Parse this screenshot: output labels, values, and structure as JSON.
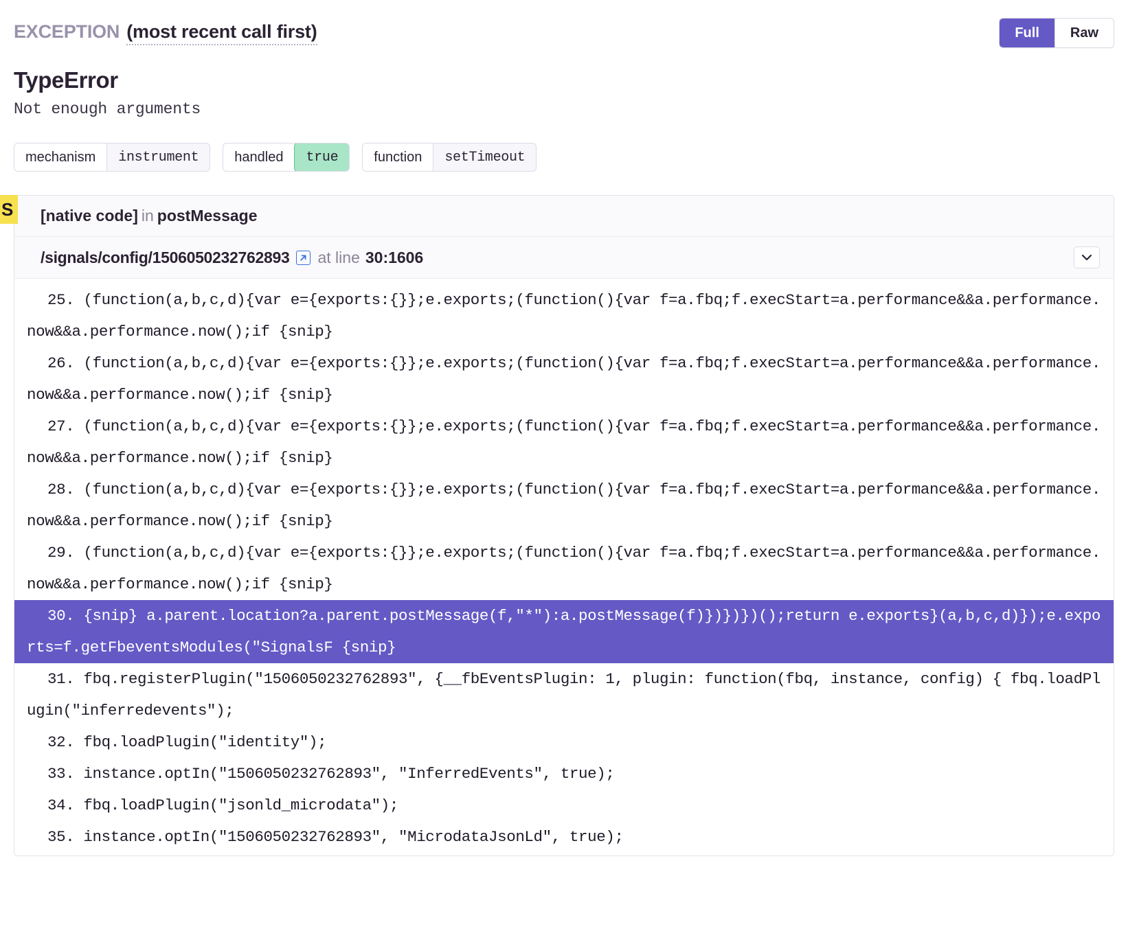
{
  "header": {
    "label": "EXCEPTION",
    "subtitle": "(most recent call first)",
    "view_modes": [
      {
        "label": "Full",
        "active": true
      },
      {
        "label": "Raw",
        "active": false
      }
    ]
  },
  "error": {
    "type": "TypeError",
    "message": "Not enough arguments"
  },
  "tags": [
    {
      "key": "mechanism",
      "value": "instrument",
      "highlight": false
    },
    {
      "key": "handled",
      "value": "true",
      "highlight": true
    },
    {
      "key": "function",
      "value": "setTimeout",
      "highlight": false
    }
  ],
  "frame": {
    "badge": "S",
    "module": "[native code]",
    "in_word": "in",
    "function_name": "postMessage",
    "file_path": "/signals/config/1506050232762893",
    "external_link_icon": "external-link-icon",
    "at_line_label": "at line",
    "line_col": "30:1606",
    "collapse_icon": "chevron-down-icon"
  },
  "code_lines": [
    {
      "number": "25.",
      "text": "(function(a,b,c,d){var e={exports:{}};e.exports;(function(){var f=a.fbq;f.execStart=a.performance&&a.performance.now&&a.performance.now();if {snip}",
      "highlighted": false
    },
    {
      "number": "26.",
      "text": "(function(a,b,c,d){var e={exports:{}};e.exports;(function(){var f=a.fbq;f.execStart=a.performance&&a.performance.now&&a.performance.now();if {snip}",
      "highlighted": false
    },
    {
      "number": "27.",
      "text": "(function(a,b,c,d){var e={exports:{}};e.exports;(function(){var f=a.fbq;f.execStart=a.performance&&a.performance.now&&a.performance.now();if {snip}",
      "highlighted": false
    },
    {
      "number": "28.",
      "text": "(function(a,b,c,d){var e={exports:{}};e.exports;(function(){var f=a.fbq;f.execStart=a.performance&&a.performance.now&&a.performance.now();if {snip}",
      "highlighted": false
    },
    {
      "number": "29.",
      "text": "(function(a,b,c,d){var e={exports:{}};e.exports;(function(){var f=a.fbq;f.execStart=a.performance&&a.performance.now&&a.performance.now();if {snip}",
      "highlighted": false
    },
    {
      "number": "30.",
      "text": "{snip} a.parent.location?a.parent.postMessage(f,\"*\"):a.postMessage(f)})})})();return e.exports}(a,b,c,d)});e.exports=f.getFbeventsModules(\"SignalsF {snip}",
      "highlighted": true
    },
    {
      "number": "31.",
      "text": "fbq.registerPlugin(\"1506050232762893\", {__fbEventsPlugin: 1, plugin: function(fbq, instance, config) { fbq.loadPlugin(\"inferredevents\");",
      "highlighted": false
    },
    {
      "number": "32.",
      "text": "fbq.loadPlugin(\"identity\");",
      "highlighted": false
    },
    {
      "number": "33.",
      "text": "instance.optIn(\"1506050232762893\", \"InferredEvents\", true);",
      "highlighted": false
    },
    {
      "number": "34.",
      "text": "fbq.loadPlugin(\"jsonld_microdata\");",
      "highlighted": false
    },
    {
      "number": "35.",
      "text": "instance.optIn(\"1506050232762893\", \"MicrodataJsonLd\", true);",
      "highlighted": false
    }
  ],
  "colors": {
    "accent": "#6559c5",
    "highlight_row": "#6559c5",
    "success": "#a8e6c7",
    "badge": "#f7e14f",
    "muted": "#8b8398"
  }
}
